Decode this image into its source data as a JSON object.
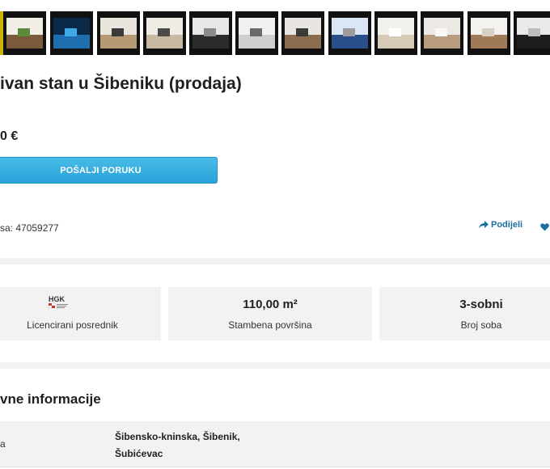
{
  "gallery": {
    "thumbnails": [
      {
        "name": "thumb-living-room-plants",
        "colors": [
          "#f3efe6",
          "#7a5a3a",
          "#5c8a3c"
        ]
      },
      {
        "name": "thumb-pool-night",
        "colors": [
          "#0a2a4a",
          "#1e6fb0",
          "#3fa9e6"
        ]
      },
      {
        "name": "thumb-dining-room",
        "colors": [
          "#ebe6dd",
          "#b69a74",
          "#3a3a3a"
        ]
      },
      {
        "name": "thumb-living-room-sofa",
        "colors": [
          "#efece6",
          "#c8b9a3",
          "#4a4a4a"
        ]
      },
      {
        "name": "thumb-kitchen-dark",
        "colors": [
          "#e7e7e7",
          "#2b2b2b",
          "#8a8a8a"
        ]
      },
      {
        "name": "thumb-living-room-white",
        "colors": [
          "#f1f1f1",
          "#cfcfcf",
          "#6a6a6a"
        ]
      },
      {
        "name": "thumb-kitchen-wide",
        "colors": [
          "#e9e6e1",
          "#8b6e4f",
          "#3a3a3a"
        ]
      },
      {
        "name": "thumb-terrace-blue",
        "colors": [
          "#d9e6f3",
          "#2a4e8a",
          "#9c9c9c"
        ]
      },
      {
        "name": "thumb-bedroom-bed",
        "colors": [
          "#f3f1ec",
          "#d8cbb5",
          "#ffffff"
        ]
      },
      {
        "name": "thumb-bedroom-wide",
        "colors": [
          "#ece9e4",
          "#b79d7e",
          "#f7f7f7"
        ]
      },
      {
        "name": "thumb-hallway",
        "colors": [
          "#f4f2ee",
          "#a07a56",
          "#d6d0c6"
        ]
      },
      {
        "name": "thumb-bedroom-dark",
        "colors": [
          "#e9e9e9",
          "#1e1e1e",
          "#bdbdbd"
        ]
      },
      {
        "name": "thumb-bathroom",
        "colors": [
          "#1a1a1a",
          "#e2e2e2",
          "#5a5a5a"
        ]
      }
    ]
  },
  "listing": {
    "title": "ivan stan u Šibeniku (prodaja)",
    "price": "0 €",
    "send_button": "POŠALJI PORUKU",
    "ad_id": "sa: 47059277",
    "share_label": "Podijeli"
  },
  "features": [
    {
      "value": "",
      "label": "Licencirani posrednik",
      "logo_text": "HGK"
    },
    {
      "value": "110,00 m²",
      "label": "Stambena površina"
    },
    {
      "value": "3-sobni",
      "label": "Broj soba"
    }
  ],
  "info": {
    "section_title": "vne informacije",
    "rows": [
      {
        "label": "a",
        "value_line1": "Šibensko-kninska, Šibenik,",
        "value_line2": "Šubićevac"
      }
    ]
  },
  "colors": {
    "accent_blue": "#2aa2d8",
    "link_blue": "#1a6fa0",
    "band_grey": "#f2f2f2"
  }
}
